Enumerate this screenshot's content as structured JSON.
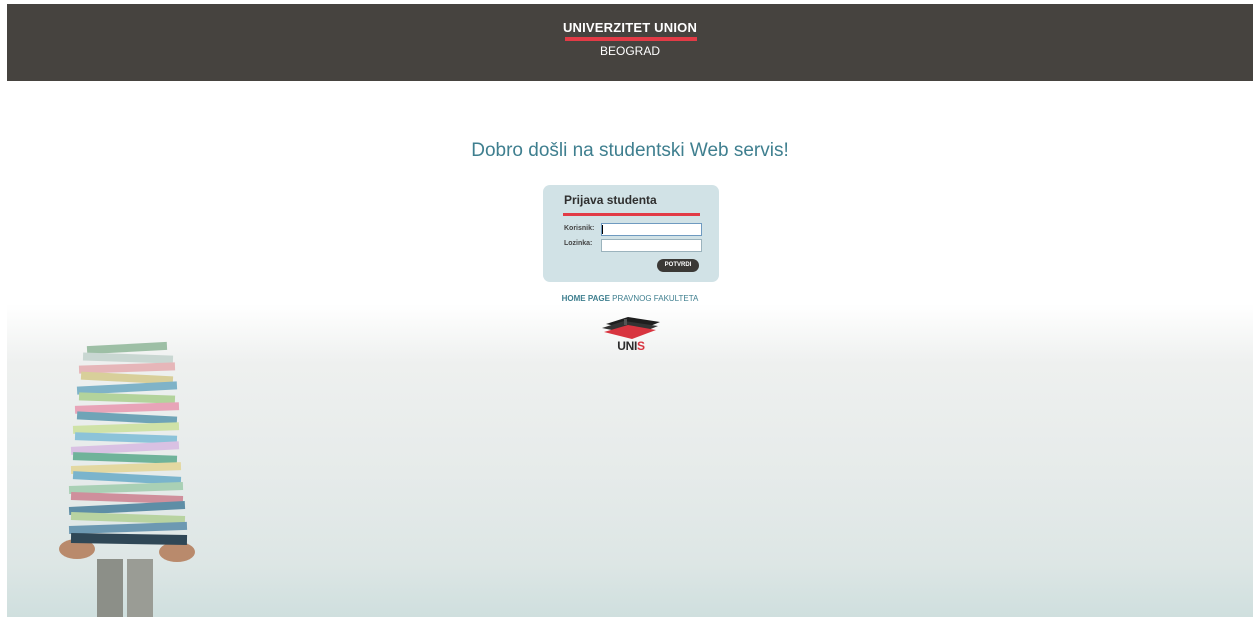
{
  "header": {
    "university": "UNIVERZITET UNION",
    "city": "BEOGRAD",
    "accent_color": "#e23b46",
    "bar_color": "#46433f"
  },
  "main": {
    "welcome": "Dobro došli na studentski Web servis!"
  },
  "login": {
    "title": "Prijava studenta",
    "user_label": "Korisnik:",
    "pass_label": "Lozinka:",
    "user_value": "",
    "pass_value": "",
    "submit_label": "POTVRDI"
  },
  "links": {
    "home_bold": "HOME PAGE",
    "home_rest": " PRAVNOG FAKULTETA"
  },
  "logo": {
    "name_main": "UNI",
    "name_accent": "S",
    "icon": "graduation-cap-icon"
  },
  "decor": {
    "image": "stack-of-folders-photo"
  }
}
